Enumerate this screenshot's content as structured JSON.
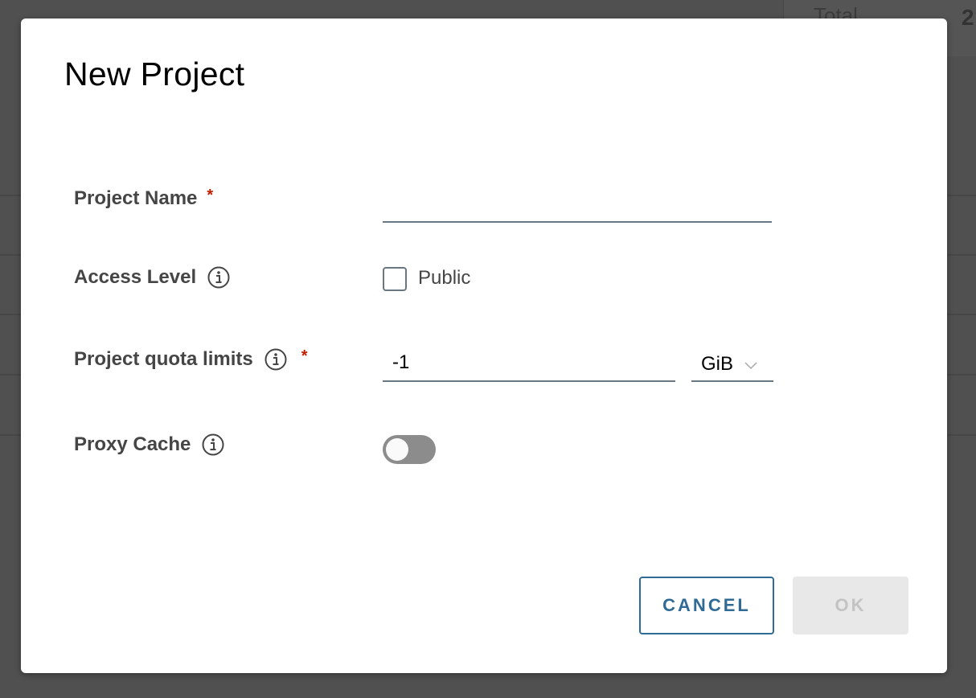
{
  "background": {
    "total_label": "Total",
    "total_count": "2"
  },
  "dialog": {
    "title": "New Project",
    "fields": {
      "project_name": {
        "label": "Project Name",
        "required_marker": "*",
        "value": ""
      },
      "access_level": {
        "label": "Access Level",
        "info_icon": "info-icon",
        "checkbox_label": "Public",
        "checked": false
      },
      "quota": {
        "label": "Project quota limits",
        "info_icon": "info-icon",
        "required_marker": "*",
        "value": "-1",
        "unit": "GiB",
        "unit_icon": "chevron-down-icon"
      },
      "proxy_cache": {
        "label": "Proxy Cache",
        "info_icon": "info-icon",
        "enabled": false
      }
    },
    "buttons": {
      "cancel": "CANCEL",
      "ok": "OK"
    },
    "colors": {
      "primary": "#2f6b95",
      "required": "#c21d00",
      "disabled_bg": "#e8e8e8",
      "disabled_text": "#c3c3c3"
    }
  }
}
